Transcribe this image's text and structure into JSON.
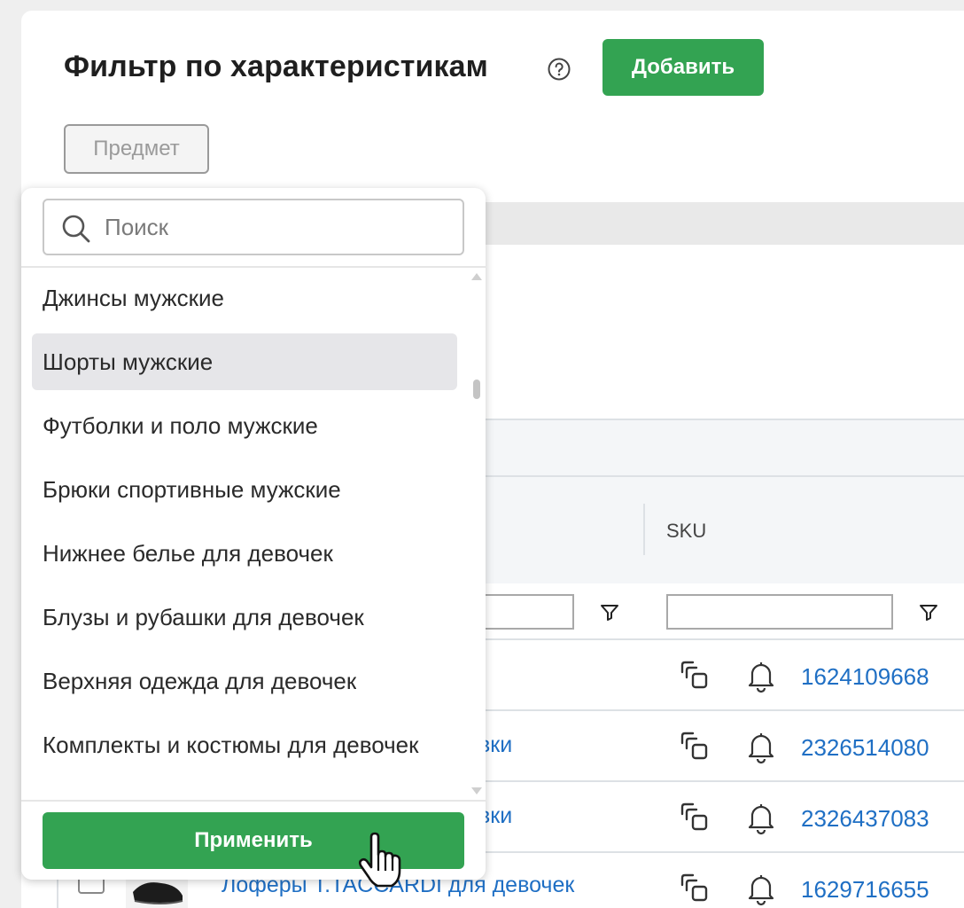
{
  "header": {
    "title": "Фильтр по характеристикам",
    "add_button": "Добавить",
    "subject_chip": "Предмет"
  },
  "dropdown": {
    "search_placeholder": "Поиск",
    "options": [
      "Джинсы мужские",
      "Шорты мужские",
      "Футболки и поло мужские",
      "Брюки спортивные мужские",
      "Нижнее белье для девочек",
      "Блузы и рубашки для девочек",
      "Верхняя одежда для девочек",
      "Комплекты и костюмы для девочек"
    ],
    "selected_option": "Шорты мужские",
    "apply_button": "Применить"
  },
  "table": {
    "columns": {
      "sku": "SKU"
    },
    "rows": [
      {
        "name": "",
        "sku": "1624109668"
      },
      {
        "name": "вки",
        "sku": "2326514080"
      },
      {
        "name": "вки",
        "sku": "2326437083"
      },
      {
        "name": "Лоферы T.TACCARDI для девочек",
        "sku": "1629716655"
      }
    ]
  },
  "colors": {
    "accent_green": "#33a352",
    "link_blue": "#1f6fc4",
    "selected_bg": "#e6e6e9"
  }
}
